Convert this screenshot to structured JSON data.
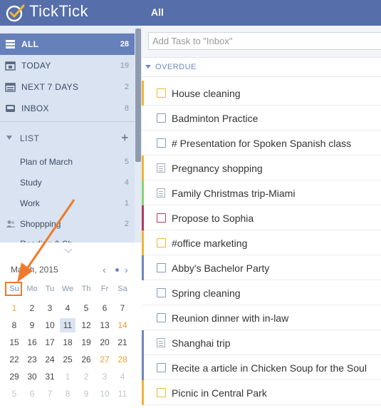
{
  "app": {
    "name": "TickTick"
  },
  "colors": {
    "header": "#566eaa",
    "sidebar": "#d9e3f1",
    "active_item": "#6680bb",
    "priority_high": "#b5375c",
    "priority_medium": "#f0b43a",
    "priority_low": "#6f87c0",
    "priority_green": "#88d57a",
    "annotation": "#f07a2a"
  },
  "sidebar": {
    "nav": [
      {
        "label": "ALL",
        "count": "28",
        "icon": "all-tasks-icon"
      },
      {
        "label": "TODAY",
        "count": "19",
        "icon": "calendar-today-icon"
      },
      {
        "label": "NEXT 7 DAYS",
        "count": "2",
        "icon": "calendar-week-icon"
      },
      {
        "label": "INBOX",
        "count": "8",
        "icon": "inbox-icon"
      }
    ],
    "list_header": {
      "label": "LIST",
      "add": "+"
    },
    "lists": [
      {
        "label": "Plan of March",
        "count": "5"
      },
      {
        "label": "Study",
        "count": "4"
      },
      {
        "label": "Work",
        "count": "1"
      },
      {
        "label": "Shoppping",
        "count": "2",
        "icon": "shared-users-icon"
      },
      {
        "label": "Reading & Sh",
        "count": ""
      }
    ]
  },
  "calendar": {
    "month": "March, 2015",
    "weekdays": [
      "Su",
      "Mo",
      "Tu",
      "We",
      "Th",
      "Fr",
      "Sa"
    ],
    "weeks": [
      [
        "1",
        "2",
        "3",
        "4",
        "5",
        "6",
        "7"
      ],
      [
        "8",
        "9",
        "10",
        "11",
        "12",
        "13",
        "14"
      ],
      [
        "15",
        "16",
        "17",
        "18",
        "19",
        "20",
        "21"
      ],
      [
        "22",
        "23",
        "24",
        "25",
        "26",
        "27",
        "28"
      ],
      [
        "29",
        "30",
        "31",
        "1",
        "2",
        "3",
        "4"
      ],
      [
        "5",
        "6",
        "7",
        "8",
        "9",
        "10",
        "11"
      ]
    ],
    "today": "11",
    "highlighted": [
      "1",
      "14",
      "27",
      "28"
    ]
  },
  "main": {
    "title": "All",
    "add_placeholder": "Add Task to \"Inbox\"",
    "section": "OVERDUE",
    "tasks": [
      {
        "title": "House cleaning",
        "type": "check",
        "priority": "medium"
      },
      {
        "title": "Badminton Practice",
        "type": "check",
        "priority": "none"
      },
      {
        "title": "# Presentation for Spoken Spanish class",
        "type": "check",
        "priority": "none"
      },
      {
        "title": "Pregnancy shopping",
        "type": "note",
        "priority": "medium"
      },
      {
        "title": "Family Christmas trip-Miami",
        "type": "note",
        "priority": "green"
      },
      {
        "title": "Propose to Sophia",
        "type": "check",
        "priority": "high"
      },
      {
        "title": "#office marketing",
        "type": "check",
        "priority": "medium"
      },
      {
        "title": "Abby's Bachelor Party",
        "type": "check",
        "priority": "low"
      },
      {
        "title": "Spring cleaning",
        "type": "check",
        "priority": "none"
      },
      {
        "title": "Reunion dinner with in-law",
        "type": "check",
        "priority": "none"
      },
      {
        "title": "Shanghai trip",
        "type": "note",
        "priority": "low"
      },
      {
        "title": "Recite a article in Chicken Soup for the Soul",
        "type": "check",
        "priority": "low"
      },
      {
        "title": "Picnic in Central Park",
        "type": "check",
        "priority": "medium"
      }
    ]
  }
}
